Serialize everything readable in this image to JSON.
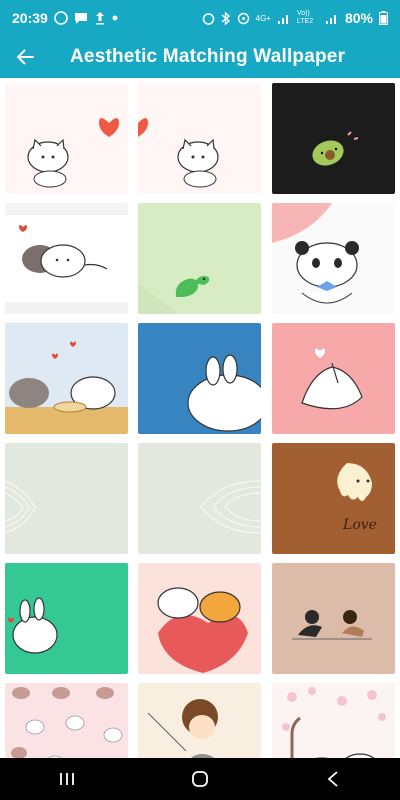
{
  "status_bar": {
    "time": "20:39",
    "network": "4G+",
    "volte": "Vo)) LTE2",
    "battery": "80%"
  },
  "app_bar": {
    "title": "Aesthetic Matching Wallpaper",
    "back_icon": "arrow-left-icon"
  },
  "wallpapers": [
    {
      "name": "cat-heart-left"
    },
    {
      "name": "cat-heart-right"
    },
    {
      "name": "avocado-black"
    },
    {
      "name": "bears-hug"
    },
    {
      "name": "green-dino"
    },
    {
      "name": "panda-bowtie"
    },
    {
      "name": "cats-noodles"
    },
    {
      "name": "blue-bunny"
    },
    {
      "name": "pink-finger-heart"
    },
    {
      "name": "fingerprint-heart-left"
    },
    {
      "name": "fingerprint-heart-right"
    },
    {
      "name": "brown-love-drip",
      "text": "Love"
    },
    {
      "name": "green-bunny"
    },
    {
      "name": "bears-heart"
    },
    {
      "name": "couple-sitting"
    },
    {
      "name": "pink-bunnies-pattern"
    },
    {
      "name": "boy-string"
    },
    {
      "name": "cats-blossom"
    }
  ],
  "nav_bar": {
    "recents_icon": "recents-icon",
    "home_icon": "home-icon",
    "back_icon": "nav-back-icon"
  },
  "colors": {
    "accent": "#17a8c4",
    "nav": "#000000"
  }
}
